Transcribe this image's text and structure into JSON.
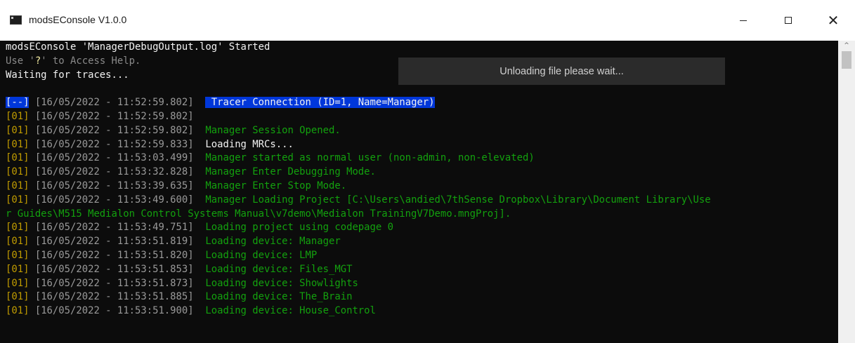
{
  "window": {
    "title": "modsEConsole V1.0.0",
    "controls": {
      "minimize": "—",
      "maximize": "☐",
      "close": "✕"
    }
  },
  "console": {
    "header": [
      {
        "parts": [
          {
            "text": "modsEConsole 'ManagerDebugOutput.log' Started",
            "style": "white"
          }
        ]
      },
      {
        "parts": [
          {
            "text": "Use '",
            "style": "gray"
          },
          {
            "text": "?",
            "style": "bright-yellow"
          },
          {
            "text": "' to Access Help.",
            "style": "gray"
          }
        ]
      },
      {
        "parts": [
          {
            "text": "Waiting for traces...",
            "style": "white"
          }
        ]
      }
    ],
    "entries": [
      {
        "tag": "[--]",
        "time": "[16/05/2022 - 11:52:59.802]",
        "message": " Tracer Connection (ID=1, Name=Manager)",
        "tag_style": "sel",
        "msg_style": "sel"
      },
      {
        "tag": "[01]",
        "time": "[16/05/2022 - 11:52:59.802]",
        "message": "",
        "tag_style": "yellow",
        "msg_style": "green"
      },
      {
        "tag": "[01]",
        "time": "[16/05/2022 - 11:52:59.802]",
        "message": "Manager Session Opened.",
        "tag_style": "yellow",
        "msg_style": "green"
      },
      {
        "tag": "[01]",
        "time": "[16/05/2022 - 11:52:59.833]",
        "message": "Loading MRCs...",
        "tag_style": "yellow",
        "msg_style": "white"
      },
      {
        "tag": "[01]",
        "time": "[16/05/2022 - 11:53:03.499]",
        "message": "Manager started as normal user (non-admin, non-elevated)",
        "tag_style": "yellow",
        "msg_style": "green"
      },
      {
        "tag": "[01]",
        "time": "[16/05/2022 - 11:53:32.828]",
        "message": "Manager Enter Debugging Mode.",
        "tag_style": "yellow",
        "msg_style": "green"
      },
      {
        "tag": "[01]",
        "time": "[16/05/2022 - 11:53:39.635]",
        "message": "Manager Enter Stop Mode.",
        "tag_style": "yellow",
        "msg_style": "green"
      },
      {
        "tag": "[01]",
        "time": "[16/05/2022 - 11:53:49.600]",
        "message": "Manager Loading Project [C:\\Users\\andied\\7thSense Dropbox\\Library\\Document Library\\Use",
        "tag_style": "yellow",
        "msg_style": "green"
      },
      {
        "tag": "",
        "time": "",
        "message": "r Guides\\M515 Medialon Control Systems Manual\\v7demo\\Medialon TrainingV7Demo.mngProj].",
        "tag_style": "yellow",
        "msg_style": "green",
        "continuation": true
      },
      {
        "tag": "[01]",
        "time": "[16/05/2022 - 11:53:49.751]",
        "message": "Loading project using codepage 0",
        "tag_style": "yellow",
        "msg_style": "green"
      },
      {
        "tag": "[01]",
        "time": "[16/05/2022 - 11:53:51.819]",
        "message": "Loading device: Manager",
        "tag_style": "yellow",
        "msg_style": "green"
      },
      {
        "tag": "[01]",
        "time": "[16/05/2022 - 11:53:51.820]",
        "message": "Loading device: LMP",
        "tag_style": "yellow",
        "msg_style": "green"
      },
      {
        "tag": "[01]",
        "time": "[16/05/2022 - 11:53:51.853]",
        "message": "Loading device: Files_MGT",
        "tag_style": "yellow",
        "msg_style": "green"
      },
      {
        "tag": "[01]",
        "time": "[16/05/2022 - 11:53:51.873]",
        "message": "Loading device: Showlights",
        "tag_style": "yellow",
        "msg_style": "green"
      },
      {
        "tag": "[01]",
        "time": "[16/05/2022 - 11:53:51.885]",
        "message": "Loading device: The_Brain",
        "tag_style": "yellow",
        "msg_style": "green"
      },
      {
        "tag": "[01]",
        "time": "[16/05/2022 - 11:53:51.900]",
        "message": "Loading device: House_Control",
        "tag_style": "yellow",
        "msg_style": "green"
      }
    ]
  },
  "overlay": {
    "text": "Unloading file please wait..."
  },
  "scrollbar": {
    "up_arrow": "^"
  },
  "colors": {
    "console_bg": "#0c0c0c",
    "tag_yellow": "#c19c00",
    "message_green": "#13a10e",
    "selection_blue": "#0037da",
    "overlay_bg": "#2b2b2b"
  }
}
